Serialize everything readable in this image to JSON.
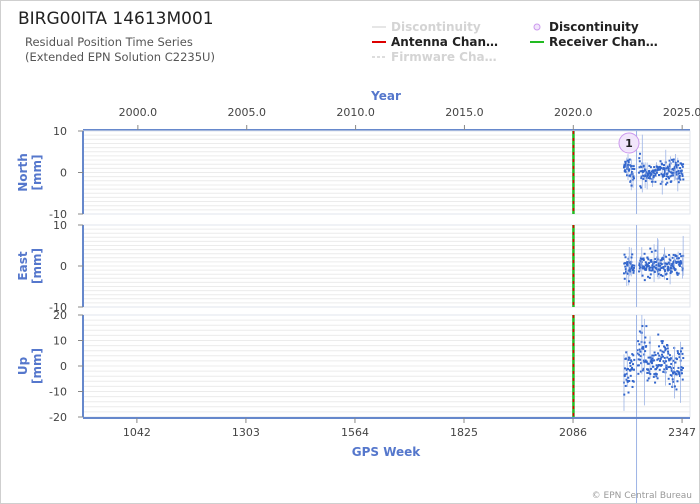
{
  "header": {
    "title": "BIRG00ITA 14613M001",
    "subtitle_line1": "Residual Position Time Series",
    "subtitle_line2": "(Extended EPN Solution C2235U)"
  },
  "legend": [
    {
      "label": "Discontinuity",
      "kind": "line",
      "color": "#e6e6e6",
      "faded": true
    },
    {
      "label": "Discontinuity",
      "kind": "dot",
      "color": "#cc99ee",
      "faded": false
    },
    {
      "label": "Antenna Chan…",
      "kind": "line",
      "color": "#dd0000",
      "faded": false
    },
    {
      "label": "Receiver Chan…",
      "kind": "line",
      "color": "#22bb22",
      "faded": false
    },
    {
      "label": "Firmware Cha…",
      "kind": "dash",
      "color": "#dddddd",
      "faded": true
    }
  ],
  "footer": {
    "credit": "© EPN Central Bureau"
  },
  "chart_data": {
    "type": "scatter",
    "colors": {
      "data": "#3366cc",
      "axis": "#6688cc",
      "label": "#5577cc",
      "antenna": "#dd0000",
      "receiver": "#22bb22",
      "discontinuity": "#cc99ee"
    },
    "top_axis": {
      "label": "Year",
      "range": [
        1997.48,
        2025.36
      ],
      "ticks": [
        2000.0,
        2005.0,
        2010.0,
        2015.0,
        2020.0,
        2025.0
      ],
      "tick_labels": [
        "2000.0",
        "2005.0",
        "2010.0",
        "2015.0",
        "2020.0",
        "2025.0"
      ]
    },
    "bottom_axis": {
      "label": "GPS Week",
      "range": [
        913,
        2366
      ],
      "ticks": [
        1042,
        1303,
        1564,
        1825,
        2086,
        2347
      ],
      "tick_labels": [
        "1042",
        "1303",
        "1564",
        "1825",
        "2086",
        "2347"
      ]
    },
    "panels": [
      {
        "label_line1": "North",
        "label_line2": "[mm]",
        "ylim": [
          -10,
          10
        ],
        "ticks": [
          -10,
          0,
          10
        ],
        "tick_labels": [
          "-10",
          "0",
          "10"
        ],
        "segments": [
          {
            "from": 2208,
            "to": 2223,
            "center": 1.0,
            "spread": 1.2
          },
          {
            "from": 2223,
            "to": 2233,
            "center": -0.5,
            "spread": 1.5
          },
          {
            "from": 2244,
            "to": 2252,
            "center": 0.5,
            "spread": 2.0
          },
          {
            "from": 2252,
            "to": 2290,
            "center": -0.3,
            "spread": 1.0
          },
          {
            "from": 2290,
            "to": 2350,
            "center": 0.4,
            "spread": 1.3
          }
        ]
      },
      {
        "label_line1": "East",
        "label_line2": "[mm]",
        "ylim": [
          -10,
          10
        ],
        "ticks": [
          -10,
          0,
          10
        ],
        "tick_labels": [
          "-10",
          "0",
          "10"
        ],
        "segments": [
          {
            "from": 2208,
            "to": 2233,
            "center": 0.0,
            "spread": 1.2
          },
          {
            "from": 2244,
            "to": 2350,
            "center": 0.2,
            "spread": 1.4
          }
        ]
      },
      {
        "label_line1": "Up",
        "label_line2": "[mm]",
        "ylim": [
          -20,
          20
        ],
        "ticks": [
          -20,
          -10,
          0,
          10,
          20
        ],
        "tick_labels": [
          "-20",
          "-10",
          "0",
          "10",
          "20"
        ],
        "segments": [
          {
            "from": 2208,
            "to": 2233,
            "center": -3.0,
            "spread": 4.0
          },
          {
            "from": 2240,
            "to": 2262,
            "center": 5.0,
            "spread": 5.0
          },
          {
            "from": 2262,
            "to": 2290,
            "center": 0.0,
            "spread": 4.0
          },
          {
            "from": 2290,
            "to": 2315,
            "center": 4.0,
            "spread": 4.0
          },
          {
            "from": 2315,
            "to": 2350,
            "center": -1.0,
            "spread": 4.0
          }
        ]
      }
    ],
    "equipment_change_week": 2087,
    "discontinuity_marker": {
      "label": "1",
      "week": 2220
    }
  }
}
